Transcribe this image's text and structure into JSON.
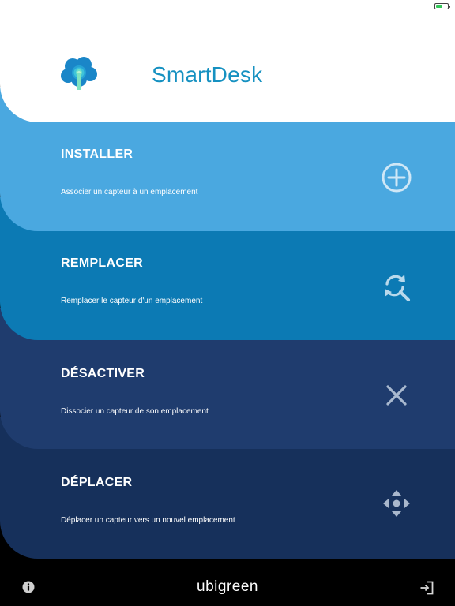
{
  "status": {
    "battery_level": 0.6,
    "battery_icon": "battery-charging-icon"
  },
  "header": {
    "app_title": "SmartDesk",
    "logo_icon": "smartdesk-logo-icon"
  },
  "actions": [
    {
      "key": "install",
      "title": "INSTALLER",
      "description": "Associer un capteur à un emplacement",
      "icon": "plus-circle-icon",
      "color": "#4aa8e0"
    },
    {
      "key": "replace",
      "title": "REMPLACER",
      "description": "Remplacer le capteur d'un emplacement",
      "icon": "refresh-search-icon",
      "color": "#0c7ab4"
    },
    {
      "key": "disable",
      "title": "DÉSACTIVER",
      "description": "Dissocier un capteur de son emplacement",
      "icon": "close-icon",
      "color": "#1f3c6e"
    },
    {
      "key": "move",
      "title": "DÉPLACER",
      "description": "Déplacer un capteur vers un nouvel emplacement",
      "icon": "move-arrows-icon",
      "color": "#16305b"
    }
  ],
  "footer": {
    "brand": "ubigreen",
    "info_icon": "info-icon",
    "logout_icon": "logout-icon"
  }
}
